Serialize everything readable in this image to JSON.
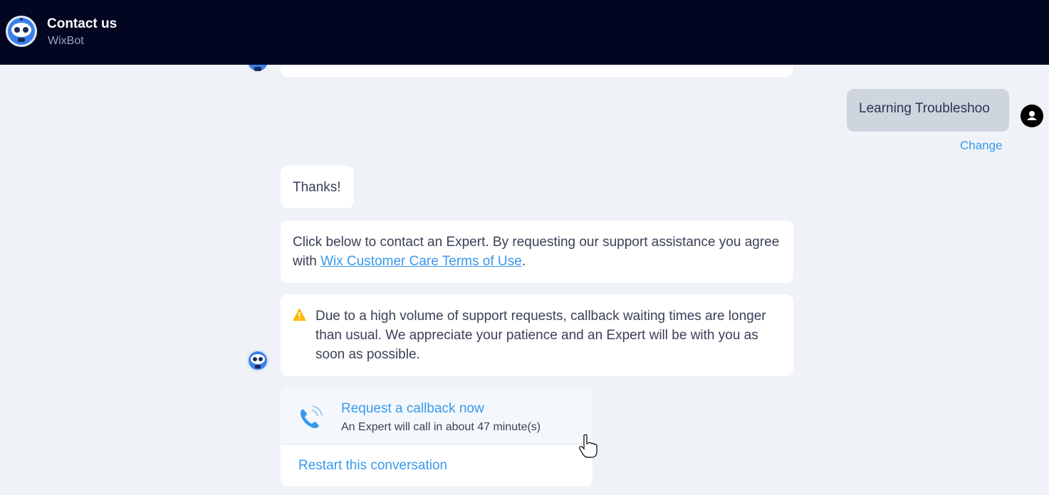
{
  "header": {
    "title": "Contact us",
    "subtitle": "WixBot",
    "avatar_icon": "robot-icon"
  },
  "user_message": {
    "text": "Learning Troubleshoo",
    "change_label": "Change",
    "avatar_icon": "user-icon"
  },
  "bot_messages": {
    "thanks": "Thanks!",
    "contact_prefix": "Click below to contact an Expert. By requesting our support assistance you agree with ",
    "contact_link": "Wix Customer Care Terms of Use",
    "contact_suffix": ".",
    "warning_icon": "warning-icon",
    "warning_text": "Due to a high volume of support requests, callback waiting times are longer than usual. We appreciate your patience and an Expert will be with you as soon as possible."
  },
  "actions": {
    "callback_title": "Request a callback now",
    "callback_sub": "An Expert will call in about 47 minute(s)",
    "restart_label": "Restart this conversation",
    "phone_icon": "phone-icon"
  },
  "colors": {
    "header_bg": "#020621",
    "accent": "#3899ec",
    "page_bg": "#eff3f7",
    "user_bubble": "#cfd5df",
    "warning": "#ffb700"
  }
}
